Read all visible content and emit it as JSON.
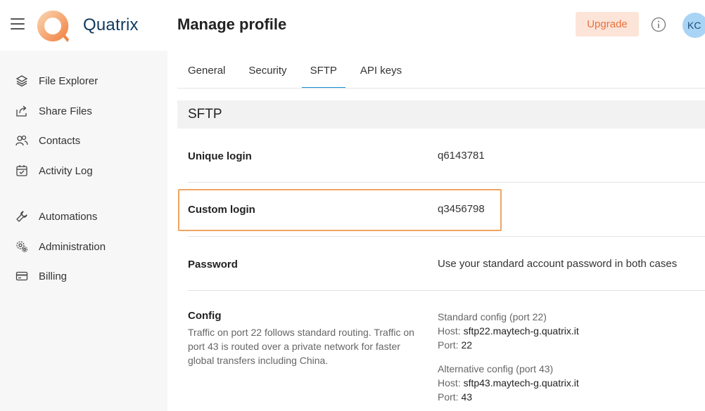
{
  "header": {
    "brand": "Quatrix",
    "page_title": "Manage profile",
    "upgrade_label": "Upgrade",
    "avatar_initials": "KC"
  },
  "sidebar": {
    "items": [
      {
        "label": "File Explorer",
        "icon": "layers-icon"
      },
      {
        "label": "Share Files",
        "icon": "share-icon"
      },
      {
        "label": "Contacts",
        "icon": "contacts-icon"
      },
      {
        "label": "Activity Log",
        "icon": "calendar-icon"
      },
      {
        "label": "Automations",
        "icon": "wrench-icon"
      },
      {
        "label": "Administration",
        "icon": "gears-icon"
      },
      {
        "label": "Billing",
        "icon": "credit-card-icon"
      }
    ]
  },
  "tabs": [
    {
      "label": "General",
      "active": false
    },
    {
      "label": "Security",
      "active": false
    },
    {
      "label": "SFTP",
      "active": true
    },
    {
      "label": "API keys",
      "active": false
    }
  ],
  "section": {
    "title": "SFTP",
    "unique_login_label": "Unique login",
    "unique_login_value": "q6143781",
    "custom_login_label": "Custom login",
    "custom_login_value": "q3456798",
    "password_label": "Password",
    "password_value": "Use your standard account password in both cases",
    "config_label": "Config",
    "config_description": "Traffic on port 22 follows standard routing. Traffic on port 43 is routed over a private network for faster global transfers including China.",
    "standard": {
      "title": "Standard config (port 22)",
      "host_label": "Host:",
      "host_value": "sftp22.maytech-g.quatrix.it",
      "port_label": "Port:",
      "port_value": "22"
    },
    "alternative": {
      "title": "Alternative config (port 43)",
      "host_label": "Host:",
      "host_value": "sftp43.maytech-g.quatrix.it",
      "port_label": "Port:",
      "port_value": "43"
    }
  },
  "colors": {
    "accent": "#1a8fd6",
    "highlight": "#f0a463",
    "upgrade_bg": "#fde4d9",
    "upgrade_text": "#e8713c",
    "brand": "#0f3a5f"
  }
}
